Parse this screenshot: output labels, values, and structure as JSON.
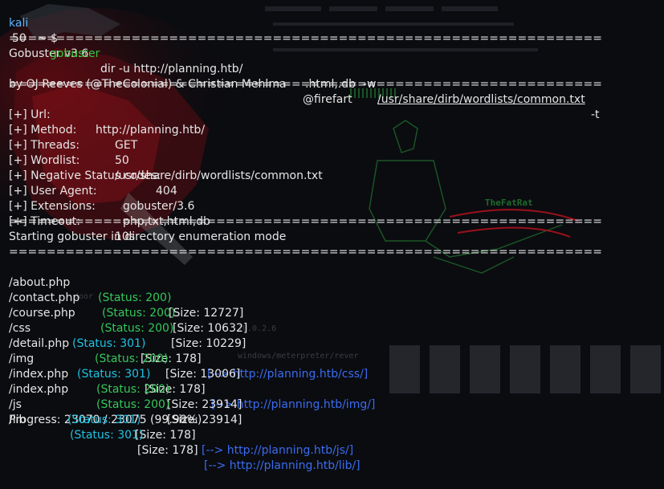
{
  "prompt": {
    "user": "kali",
    "symbol": "~ $",
    "command": "gobuster",
    "args_1": "dir -u http://planning.htb/",
    "args_2": ".html,.db  -w",
    "wordlist_path": "/usr/share/dirb/wordlists/common.txt",
    "args_3": "-t",
    "threads_cont": "50"
  },
  "separator": "===============================================================",
  "banner": {
    "version": "Gobuster v3.6",
    "authors": "by OJ Reeves (@TheColonial) & Christian Mehlma",
    "authors_handle": "@firefart"
  },
  "config": [
    {
      "label": "[+] Url:",
      "value": "http://planning.htb/"
    },
    {
      "label": "[+] Method:",
      "value": "GET"
    },
    {
      "label": "[+] Threads:",
      "value": "50"
    },
    {
      "label": "[+] Wordlist:",
      "value": "/usr/share/dirb/wordlists/common.txt"
    },
    {
      "label": "[+] Negative Status codes:",
      "value": "404"
    },
    {
      "label": "[+] User Agent:",
      "value": "gobuster/3.6"
    },
    {
      "label": "[+] Extensions:",
      "value": "php,txt,html,db"
    },
    {
      "label": "[+] Timeout:",
      "value": "10s"
    }
  ],
  "start_message": "Starting gobuster in directory enumeration mode",
  "results": [
    {
      "path": "/about.php",
      "status": "(Status: 200)",
      "size": "[Size: 12727]",
      "redirect": ""
    },
    {
      "path": "/contact.php",
      "status": "(Status: 200)",
      "size": "[Size: 10632]",
      "redirect": ""
    },
    {
      "path": "/course.php",
      "status": "(Status: 200)",
      "size": "[Size: 10229]",
      "redirect": ""
    },
    {
      "path": "/css",
      "status": "(Status: 301)",
      "size": "[Size: 178]",
      "redirect": "[--> http://planning.htb/css/]"
    },
    {
      "path": "/detail.php",
      "status": "(Status: 200)",
      "size": "[Size: 13006]",
      "redirect": ""
    },
    {
      "path": "/img",
      "status": "(Status: 301)",
      "size": "[Size: 178]",
      "redirect": "[--> http://planning.htb/img/]"
    },
    {
      "path": "/index.php",
      "status": "(Status: 200)",
      "size": "[Size: 23914]",
      "redirect": ""
    },
    {
      "path": "/index.php",
      "status": "(Status: 200)",
      "size": "[Size: 23914]",
      "redirect": ""
    },
    {
      "path": "/js",
      "status": "(Status: 301)",
      "size": "[Size: 178]",
      "redirect": "[--> http://planning.htb/js/]"
    },
    {
      "path": "/lib",
      "status": "(Status: 301)",
      "size": "[Size: 178]",
      "redirect": "[--> http://planning.htb/lib/]"
    }
  ],
  "progress": {
    "text": "Progress: 23070 / 23075 (99.98%)",
    "fraction": 0.9998
  },
  "wallpaper": {
    "fatrat_label": "TheFatRat",
    "ip_text": "10.0.2.6",
    "payload_text": "windows/meterpreter/rever",
    "door_text": "door",
    "colors": {
      "background": "#0b0c10",
      "red": "#b3121c",
      "green_art": "#1f6b2c",
      "text": "#e6e6e6",
      "ok": "#34c759",
      "redirect_status": "#1ec2e0",
      "redirect_link": "#3a6cf0",
      "prompt_user": "#5fb3ff",
      "prompt_cmd": "#2ecc40"
    }
  }
}
